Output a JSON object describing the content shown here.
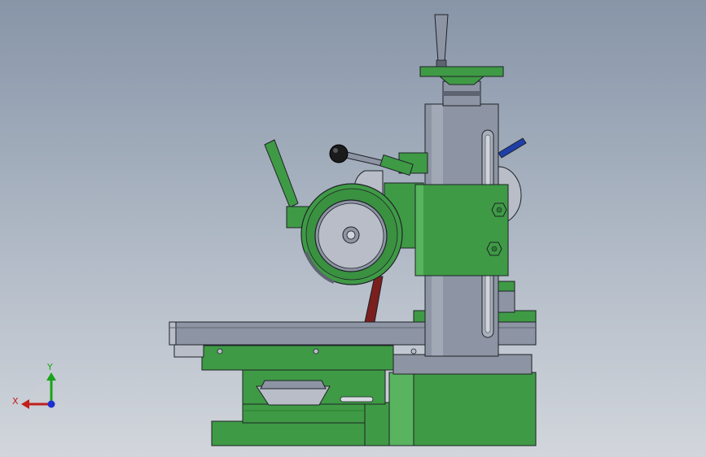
{
  "viewport": {
    "background_top": "#8795a8",
    "background_bottom": "#d2d6dc"
  },
  "colors": {
    "green": "#3f9a45",
    "green_dark": "#2b7a32",
    "green_light": "#58b45e",
    "gray": "#8d94a3",
    "gray_light": "#b8bdc7",
    "gray_dark": "#5d6370",
    "outline": "#1e2228",
    "dark_red": "#7a1e1e",
    "blue": "#1f3fa8",
    "black_knob": "#1b1b1b",
    "axis_x": "#c0201b",
    "axis_y": "#1aa31a",
    "axis_origin": "#1d2fd0"
  },
  "triad": {
    "x_label": "X",
    "y_label": "Y"
  },
  "icons": {
    "triad": "xyz-axis-triad-icon",
    "handwheel": "handwheel-icon",
    "lever": "lever-handle-icon"
  }
}
